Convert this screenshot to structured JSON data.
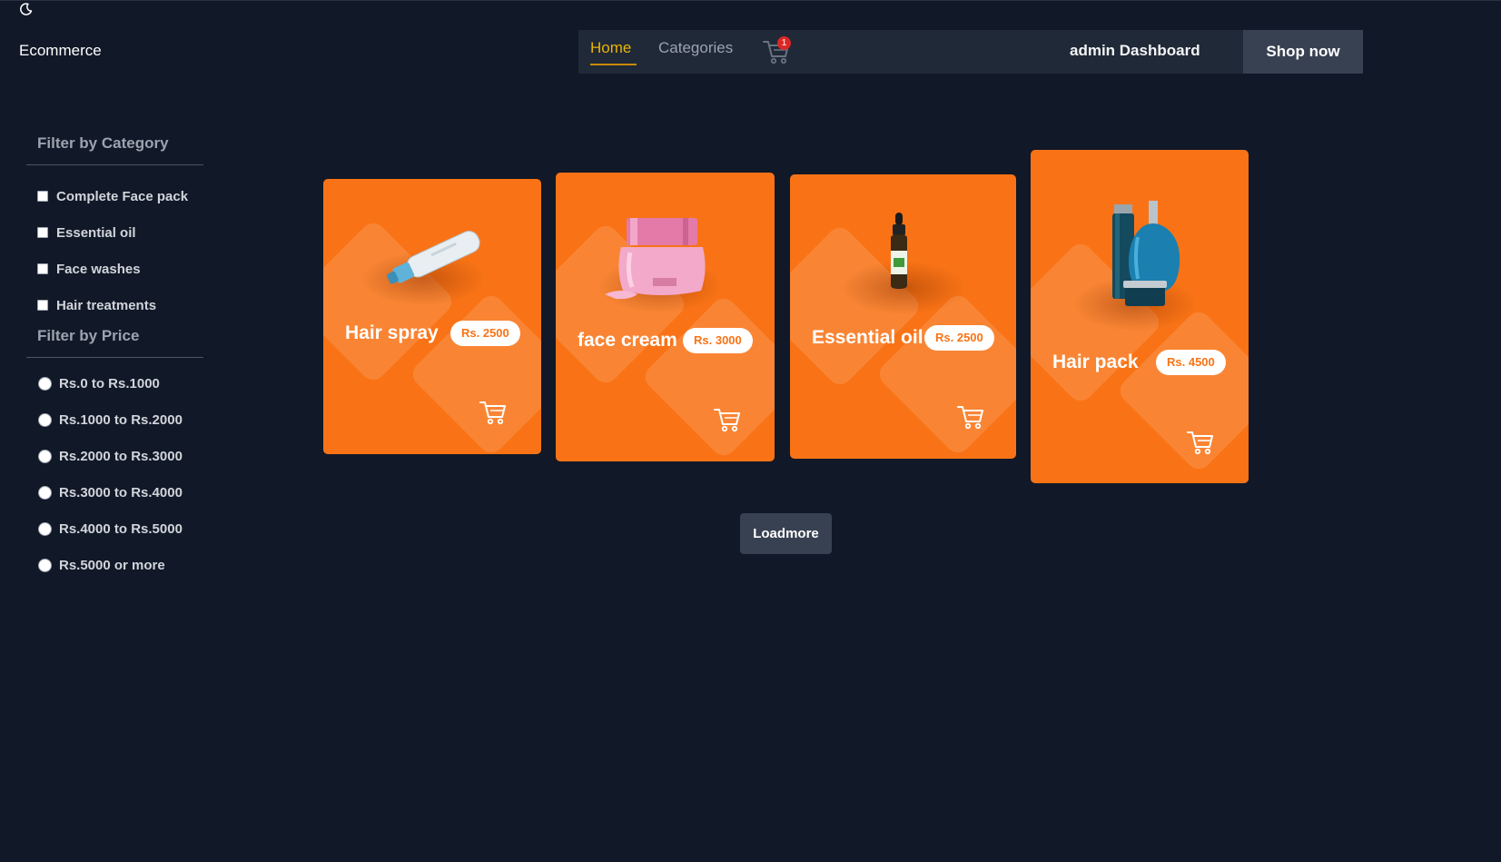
{
  "brand": "Ecommerce",
  "nav": {
    "home": "Home",
    "categories": "Categories",
    "cart_count": "1",
    "admin": "admin Dashboard",
    "shop_now": "Shop now"
  },
  "filters": {
    "category_title": "Filter by Category",
    "categories": [
      "Complete Face pack",
      "Essential oil",
      "Face washes",
      "Hair treatments"
    ],
    "price_title": "Filter by Price",
    "prices": [
      "Rs.0 to Rs.1000",
      "Rs.1000 to Rs.2000",
      "Rs.2000 to Rs.3000",
      "Rs.3000 to Rs.4000",
      "Rs.4000 to Rs.5000",
      "Rs.5000 or more"
    ]
  },
  "products": [
    {
      "name": "Hair spray",
      "price": "Rs. 2500"
    },
    {
      "name": "face cream",
      "price": "Rs. 3000"
    },
    {
      "name": "Essential oil",
      "price": "Rs. 2500"
    },
    {
      "name": "Hair pack",
      "price": "Rs. 4500"
    }
  ],
  "loadmore": "Loadmore",
  "colors": {
    "background": "#111827",
    "card": "#f97316",
    "nav_active": "#eab308",
    "button": "#374151",
    "badge": "#dc2626"
  },
  "icons": [
    "moon-icon",
    "cart-icon"
  ]
}
